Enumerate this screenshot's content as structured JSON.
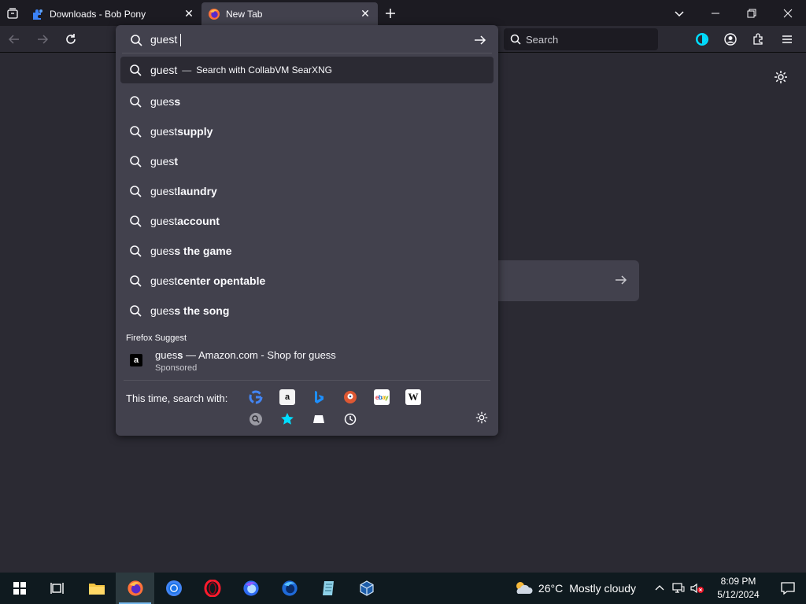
{
  "tabs": [
    {
      "title": "Downloads - Bob Pony",
      "icon": "puzzle-favicon",
      "active": false
    },
    {
      "title": "New Tab",
      "icon": "firefox-favicon",
      "active": true
    }
  ],
  "toolbar": {
    "search_placeholder": "Search"
  },
  "urlbar": {
    "value": "guest",
    "heuristic": {
      "typed": "guest",
      "action": "Search with CollabVM SearXNG"
    },
    "suggestions": [
      {
        "typed": "gues",
        "bold": "s"
      },
      {
        "typed": "guest",
        "bold": " supply"
      },
      {
        "typed": "gues",
        "bold": "t"
      },
      {
        "typed": "guest",
        "bold": " laundry"
      },
      {
        "typed": "guest",
        "bold": " account"
      },
      {
        "typed": "gues",
        "bold": "s the game"
      },
      {
        "typed": "guest",
        "bold": " center opentable"
      },
      {
        "typed": "gues",
        "bold": "s the song"
      }
    ],
    "suggest_label": "Firefox Suggest",
    "sponsored": {
      "typed": "gues",
      "bold": "s",
      "title": " — Amazon.com - Shop for guess",
      "label": "Sponsored"
    },
    "oneoff_label": "This time, search with:",
    "engines": [
      "google-icon",
      "amazon-icon",
      "bing-icon",
      "duckduckgo-icon",
      "ebay-icon",
      "wikipedia-icon",
      "searxng-icon",
      "bookmarks-star-icon",
      "tabs-icon",
      "history-clock-icon"
    ]
  },
  "taskbar": {
    "apps": [
      "start-button",
      "task-view",
      "file-explorer",
      "firefox",
      "chrome",
      "opera",
      "firefox-developer",
      "firefox-nightly",
      "notepad-app",
      "virtualbox"
    ],
    "weather_temp": "26°C",
    "weather_text": "Mostly cloudy",
    "time": "8:09 PM",
    "date": "5/12/2024"
  },
  "colors": {
    "accent": "#0060df",
    "panel": "#42414d",
    "toolbar": "#2b2a33",
    "background": "#1c1b22"
  }
}
